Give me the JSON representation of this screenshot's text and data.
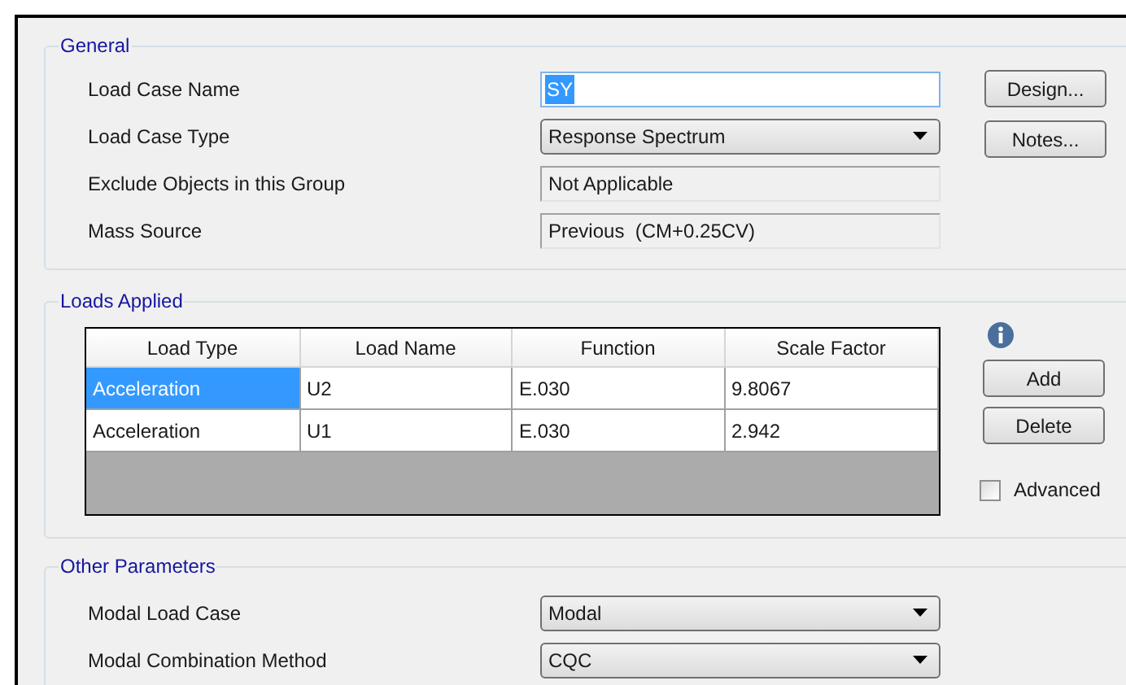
{
  "general": {
    "title": "General",
    "fields": [
      {
        "label": "Load Case Name",
        "kind": "text",
        "value": "SY",
        "text_selected": true
      },
      {
        "label": "Load Case Type",
        "kind": "dropdown",
        "value": "Response Spectrum"
      },
      {
        "label": "Exclude Objects in this Group",
        "kind": "readonly",
        "value": "Not Applicable"
      },
      {
        "label": "Mass Source",
        "kind": "readonly",
        "value": "Previous  (CM+0.25CV)"
      }
    ],
    "buttons": [
      "Design...",
      "Notes..."
    ]
  },
  "loads_applied": {
    "title": "Loads Applied",
    "table": {
      "columns": [
        "Load Type",
        "Load Name",
        "Function",
        "Scale Factor"
      ],
      "rows": [
        {
          "cells": [
            "Acceleration",
            "U2",
            "E.030",
            "9.8067"
          ],
          "selected": true
        },
        {
          "cells": [
            "Acceleration",
            "U1",
            "E.030",
            "2.942"
          ],
          "selected": false
        }
      ]
    },
    "buttons": [
      "Add",
      "Delete"
    ],
    "advanced": {
      "label": "Advanced",
      "checked": false
    }
  },
  "other_parameters": {
    "title": "Other Parameters",
    "fields": [
      {
        "label": "Modal Load Case",
        "kind": "dropdown",
        "value": "Modal"
      },
      {
        "label": "Modal Combination Method",
        "kind": "dropdown",
        "value": "CQC"
      }
    ]
  }
}
